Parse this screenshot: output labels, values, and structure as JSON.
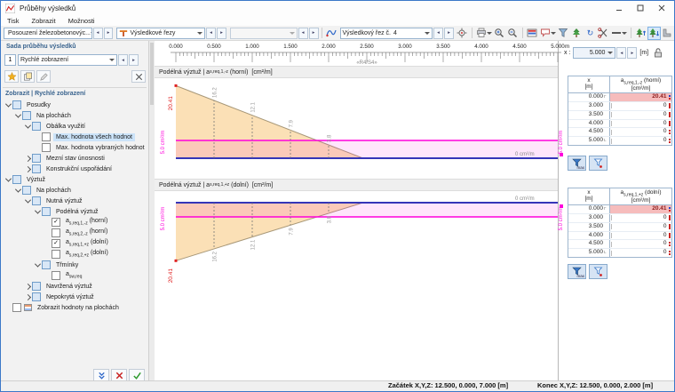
{
  "window": {
    "title": "Průběhy výsledků"
  },
  "menu": {
    "items": [
      "Tisk",
      "Zobrazit",
      "Možnosti"
    ]
  },
  "toolbar": {
    "design_case": "Posouzení železobetonovýc...",
    "view_type": "Výsledkové řezy",
    "empty_combo": "",
    "result_section_label": "Výsledkový řez č.",
    "result_section_value": "4"
  },
  "panel": {
    "header": "Sada průběhu výsledků",
    "set_index": "1",
    "set_name": "Rychlé zobrazení",
    "filter_header": "Zobrazit | Rychlé zobrazení",
    "tree": [
      {
        "indent": 0,
        "exp": "open",
        "cb": "partial",
        "text": "Posudky"
      },
      {
        "indent": 1,
        "exp": "open",
        "cb": "partial",
        "text": "Na plochách"
      },
      {
        "indent": 2,
        "exp": "open",
        "cb": "partial",
        "text": "Obálka využití"
      },
      {
        "indent": 3,
        "cb": "unchecked",
        "selected": true,
        "text": "Max. hodnota všech hodnot"
      },
      {
        "indent": 3,
        "cb": "unchecked",
        "text": "Max. hodnota vybraných hodnot"
      },
      {
        "indent": 2,
        "exp": "closed",
        "cb": "partial",
        "text": "Mezní stav únosnosti"
      },
      {
        "indent": 2,
        "exp": "closed",
        "cb": "partial",
        "text": "Konstrukční uspořádání"
      },
      {
        "indent": 0,
        "exp": "open",
        "cb": "partial",
        "text": "Výztuž"
      },
      {
        "indent": 1,
        "exp": "open",
        "cb": "partial",
        "text": "Na plochách"
      },
      {
        "indent": 2,
        "exp": "open",
        "cb": "partial",
        "text": "Nutná výztuž"
      },
      {
        "indent": 3,
        "exp": "open",
        "cb": "partial",
        "text": "Podélná výztuž"
      },
      {
        "indent": 4,
        "cb": "checked",
        "pre": "a",
        "sub": "s,req,1,-z",
        "post": " (horní)"
      },
      {
        "indent": 4,
        "cb": "unchecked",
        "pre": "a",
        "sub": "s,req,2,-z",
        "post": " (horní)"
      },
      {
        "indent": 4,
        "cb": "checked",
        "pre": "a",
        "sub": "s,req,1,+z",
        "post": " (dolní)"
      },
      {
        "indent": 4,
        "cb": "unchecked",
        "pre": "a",
        "sub": "s,req,2,+z",
        "post": " (dolní)"
      },
      {
        "indent": 3,
        "exp": "open",
        "cb": "partial",
        "text": "Třmínky"
      },
      {
        "indent": 4,
        "cb": "unchecked",
        "pre": "a",
        "sub": "sw,req",
        "post": ""
      },
      {
        "indent": 2,
        "exp": "closed",
        "cb": "partial",
        "text": "Navržená výztuž"
      },
      {
        "indent": 2,
        "exp": "closed",
        "cb": "partial",
        "text": "Nepokrytá výztuž"
      },
      {
        "indent": 0,
        "cb": "unchecked",
        "icon": true,
        "text": "Zobrazit hodnoty na plochách"
      }
    ]
  },
  "ruler": {
    "labels": [
      "0.000",
      "0.500",
      "1.000",
      "1.500",
      "2.000",
      "2.500",
      "3.000",
      "3.500",
      "4.000",
      "4.500",
      "5.000"
    ],
    "unit": "m",
    "section_tag": "«R4/S4»"
  },
  "x_control": {
    "label": "x :",
    "value": "5.000",
    "unit": "[m]"
  },
  "chart_data": [
    {
      "type": "area",
      "title": "Podélná výztuž | as,req,1,-z (horní) [cm²/m]",
      "title_pre": "Podélná výztuž | a",
      "title_sub": "s,req,1,-z",
      "title_post": " (horní)  [cm²/m]",
      "x_unit": "m",
      "y_unit": "cm²/m",
      "x_range": [
        0,
        5
      ],
      "y_max": 20.41,
      "orientation": "up",
      "series": [
        {
          "name": "required-reinforcement",
          "points": [
            [
              0,
              20.41
            ],
            [
              2.45,
              0
            ],
            [
              5,
              0
            ]
          ]
        },
        {
          "name": "provided-reinforcement",
          "constant": 5.0
        }
      ],
      "point_labels": [
        {
          "x": 0.5,
          "label": "16.2"
        },
        {
          "x": 1.0,
          "label": "12.1"
        },
        {
          "x": 1.5,
          "label": "7.9"
        },
        {
          "x": 2.0,
          "label": "3.8"
        }
      ],
      "max_label": "20.41",
      "provided_label": "5.0 cm²/m",
      "zero_label": "0 cm²/m"
    },
    {
      "type": "area",
      "title": "Podélná výztuž | as,req,1,+z (dolní) [cm²/m]",
      "title_pre": "Podélná výztuž | a",
      "title_sub": "s,req,1,+z",
      "title_post": " (dolní)  [cm²/m]",
      "x_unit": "m",
      "y_unit": "cm²/m",
      "x_range": [
        0,
        5
      ],
      "y_max": 20.41,
      "orientation": "down",
      "series": [
        {
          "name": "required-reinforcement",
          "points": [
            [
              0,
              20.41
            ],
            [
              2.45,
              0
            ],
            [
              5,
              0
            ]
          ]
        },
        {
          "name": "provided-reinforcement",
          "constant": 5.0
        }
      ],
      "point_labels": [
        {
          "x": 0.5,
          "label": "16.2"
        },
        {
          "x": 1.0,
          "label": "12.1"
        },
        {
          "x": 1.5,
          "label": "7.9"
        },
        {
          "x": 2.0,
          "label": "3.8"
        }
      ],
      "max_label": "20.41",
      "provided_label": "5.0 cm²/m",
      "zero_label": "0 cm²/m"
    }
  ],
  "tables": [
    {
      "header": {
        "col1_l1": "x",
        "col1_l2": "[m]",
        "col2_pre": "a",
        "col2_sub": "s,req,1,-z",
        "col2_post": " (horní)",
        "col2_l2": "[cm²/m]"
      },
      "rows": [
        {
          "x": "0.000",
          "marker": "Γ",
          "value": "20.41",
          "highlight": true
        },
        {
          "x": "3.000",
          "marker": "",
          "value": "0"
        },
        {
          "x": "3.500",
          "marker": "",
          "value": "0"
        },
        {
          "x": "4.000",
          "marker": "",
          "value": "0"
        },
        {
          "x": "4.500",
          "marker": "",
          "value": "0"
        },
        {
          "x": "5.000",
          "marker": "L",
          "value": "0"
        }
      ],
      "filter_max_label": "max"
    },
    {
      "header": {
        "col1_l1": "x",
        "col1_l2": "[m]",
        "col2_pre": "a",
        "col2_sub": "s,req,1,+z",
        "col2_post": " (dolní)",
        "col2_l2": "[cm²/m]"
      },
      "rows": [
        {
          "x": "0.000",
          "marker": "Γ",
          "value": "20.41",
          "highlight": true
        },
        {
          "x": "3.000",
          "marker": "",
          "value": "0"
        },
        {
          "x": "3.500",
          "marker": "",
          "value": "0"
        },
        {
          "x": "4.000",
          "marker": "",
          "value": "0"
        },
        {
          "x": "4.500",
          "marker": "",
          "value": "0"
        },
        {
          "x": "5.000",
          "marker": "L",
          "value": "0"
        }
      ],
      "filter_max_label": "max"
    }
  ],
  "status_bar": {
    "start": "Začátek X,Y,Z: 12.500, 0.000, 7.000 [m]",
    "end": "Konec X,Y,Z: 12.500, 0.000, 2.000 [m]"
  },
  "colors": {
    "accent_magenta": "#FF00DC",
    "required_fill": "#FBE0B6",
    "baseline_navy": "#3535B8",
    "max_red": "#E02020",
    "row_highlight": "#F6BCBC",
    "selection": "#CBE3F9"
  }
}
